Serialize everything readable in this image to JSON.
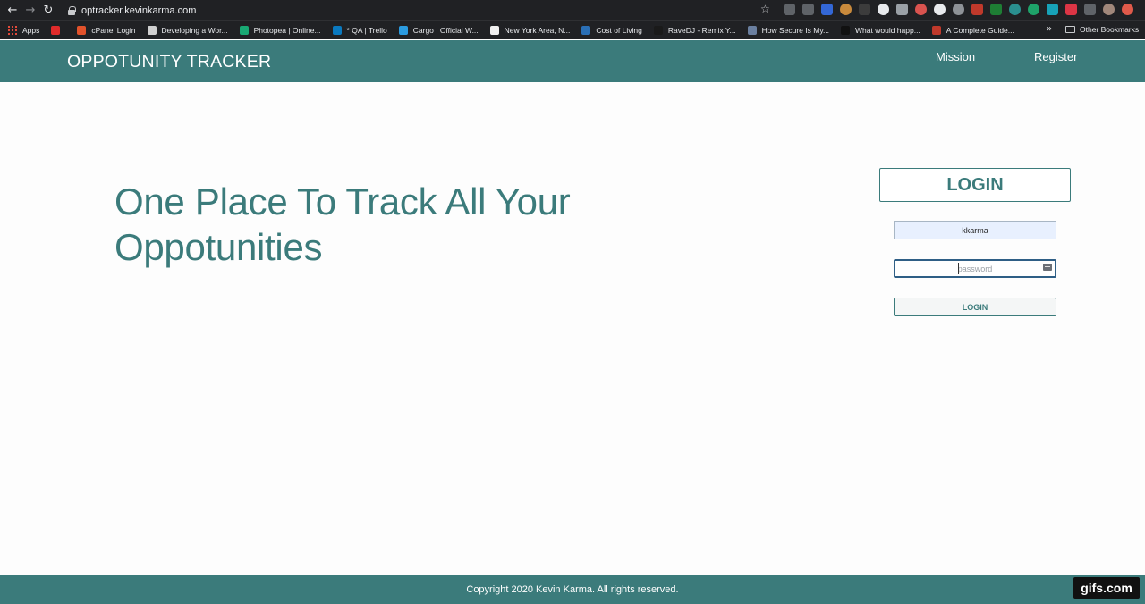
{
  "browser": {
    "url": "optracker.kevinkarma.com",
    "bookmarks": [
      {
        "label": "Apps",
        "color": "#e24a3b"
      },
      {
        "label": "",
        "color": "#e02b2b"
      },
      {
        "label": "cPanel Login",
        "color": "#e2522b"
      },
      {
        "label": "Developing a Wor...",
        "color": "#d0d0d0"
      },
      {
        "label": "Photopea | Online...",
        "color": "#19a974"
      },
      {
        "label": "* QA | Trello",
        "color": "#0a79bf"
      },
      {
        "label": "Cargo | Official W...",
        "color": "#2b9be0"
      },
      {
        "label": "New York Area, N...",
        "color": "#f0f0f0"
      },
      {
        "label": "Cost of Living",
        "color": "#2a6fb5"
      },
      {
        "label": "RaveDJ - Remix Y...",
        "color": "#1a1a1a"
      },
      {
        "label": "How Secure Is My...",
        "color": "#6a7f9f"
      },
      {
        "label": "What would happ...",
        "color": "#111111"
      },
      {
        "label": "A Complete Guide...",
        "color": "#c0392b"
      }
    ],
    "other_bookmarks": "Other Bookmarks"
  },
  "header": {
    "brand": "OPPOTUNITY TRACKER",
    "nav": {
      "mission": "Mission",
      "register": "Register"
    }
  },
  "hero": {
    "line1": "One Place To Track All Your",
    "line2": "Oppotunities"
  },
  "login": {
    "title": "LOGIN",
    "username_value": "kkarma",
    "password_placeholder": "password",
    "button_label": "LOGIN"
  },
  "footer": {
    "copyright": "Copyright 2020 Kevin Karma. All rights reserved."
  },
  "watermark": "gifs.com",
  "colors": {
    "brand": "#3b7b7b",
    "chrome": "#202124"
  }
}
